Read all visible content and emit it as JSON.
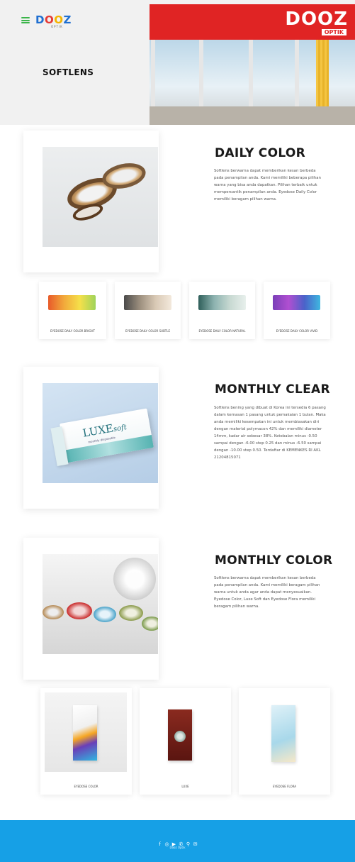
{
  "header": {
    "logo": {
      "letters": [
        "D",
        "O",
        "O",
        "Z"
      ],
      "sub": "OPTIK"
    },
    "title": "SOFTLENS",
    "storefront": {
      "sign": "DOOZ",
      "sub": "OPTIK"
    }
  },
  "sections": [
    {
      "title": "DAILY COLOR",
      "description": "Softlens berwarna dapat memberikan kesan berbeda pada penampilan anda. Kami memiliki beberapa pilihan warna yang bisa anda dapatkan. Pilihan terbaik untuk mempercantik penampilan anda. Eyedose Daily Color memiliki beragam pilihan warna."
    },
    {
      "title": "MONTHLY CLEAR",
      "description": "Softlens bening yang dibuat di Korea ini tersedia 6 pasang dalam kemasan 1 pasang untuk pemakaian 1 bulan. Maka anda memiliki kesempatan ini untuk membiasakan diri dengan material polymacon 42% dan memiliki diameter 14mm, kadar air sebesar 38%. Ketebalan minus -0.50 sampai dengan -6.00 step 0.25 dan minus -6.50 sampai dengan -10.00 step 0.50. Terdaftar di KEMENKES RI AKL 21204815071"
    },
    {
      "title": "MONTHLY COLOR",
      "description": "Softlens berwarna dapat memberikan kesan berbeda pada penampilan anda. Kami memiliki beragam pilihan warna untuk anda agar anda dapat menyesuaikan. Eyedose Color, Luxe Soft dan Eyedose Flora memiliki beragam pilihan warna."
    }
  ],
  "daily_products": [
    {
      "label": "EYEDOSE DAILY COLOR BRIGHT",
      "colors": [
        "#e85a2a",
        "#f2a93b",
        "#f5e04a",
        "#9fd35a"
      ]
    },
    {
      "label": "EYEDOSE DAILY COLOR SUBTLE",
      "colors": [
        "#4a4a4a",
        "#9c8f7e",
        "#d9c9b5",
        "#f3e9dc"
      ]
    },
    {
      "label": "EYEDOSE DAILY COLOR NATURAL",
      "colors": [
        "#2f5f5a",
        "#8db3b0",
        "#c8d9d2",
        "#e8f0ec"
      ]
    },
    {
      "label": "EYEDOSE DAILY COLOR VIVID",
      "colors": [
        "#7a3fb8",
        "#b04fd1",
        "#4a62c9",
        "#3fb7e0"
      ]
    }
  ],
  "clear_box": {
    "brand": "LUXE",
    "script": "soft",
    "sub": "monthly disposable"
  },
  "monthly_products": [
    {
      "label": "EYEDOSE COLOR"
    },
    {
      "label": "LUXE"
    },
    {
      "label": "EYEDOSE FLORA"
    }
  ],
  "footer": {
    "icons": [
      "facebook-icon",
      "instagram-icon",
      "youtube-icon",
      "whatsapp-icon",
      "location-icon",
      "mail-icon"
    ],
    "copyright": "Dooz Optik"
  }
}
